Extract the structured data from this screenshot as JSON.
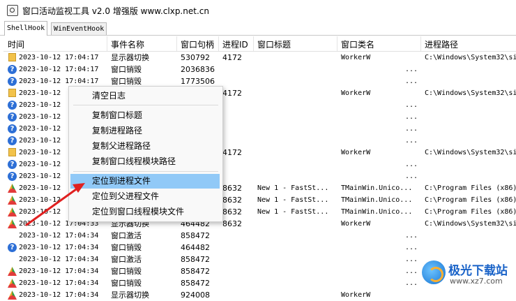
{
  "window": {
    "title": "窗口活动监视工具 v2.0 增强版 www.clxp.net.cn"
  },
  "tabs": [
    {
      "label": "ShellHook"
    },
    {
      "label": "WinEventHook"
    }
  ],
  "columns": [
    "时间",
    "事件名称",
    "窗口句柄",
    "进程ID",
    "窗口标题",
    "窗口类名",
    "进程路径"
  ],
  "rows": [
    {
      "icon": "folder-icon",
      "time": "2023-10-12 17:04:17",
      "event": "显示器切换",
      "hwnd": "530792",
      "pid": "4172",
      "wtitle": "",
      "cls": "WorkerW",
      "path": "C:\\Windows\\System32\\si"
    },
    {
      "icon": "help-icon",
      "time": "2023-10-12 17:04:17",
      "event": "窗口销毁",
      "hwnd": "2036836",
      "pid": "",
      "wtitle": "",
      "cls": "...",
      "path": ""
    },
    {
      "icon": "help-icon",
      "time": "2023-10-12 17:04:17",
      "event": "窗口销毁",
      "hwnd": "1773506",
      "pid": "",
      "wtitle": "",
      "cls": "...",
      "path": ""
    },
    {
      "icon": "folder-icon",
      "time": "2023-10-12",
      "event": "",
      "hwnd": "",
      "pid": "4172",
      "wtitle": "",
      "cls": "WorkerW",
      "path": "C:\\Windows\\System32\\si"
    },
    {
      "icon": "help-icon",
      "time": "2023-10-12",
      "event": "",
      "hwnd": "",
      "pid": "",
      "wtitle": "",
      "cls": "...",
      "path": ""
    },
    {
      "icon": "help-icon",
      "time": "2023-10-12",
      "event": "",
      "hwnd": "",
      "pid": "",
      "wtitle": "",
      "cls": "...",
      "path": ""
    },
    {
      "icon": "help-icon",
      "time": "2023-10-12",
      "event": "",
      "hwnd": "",
      "pid": "",
      "wtitle": "",
      "cls": "...",
      "path": ""
    },
    {
      "icon": "help-icon",
      "time": "2023-10-12",
      "event": "",
      "hwnd": "",
      "pid": "",
      "wtitle": "",
      "cls": "...",
      "path": ""
    },
    {
      "icon": "folder-icon",
      "time": "2023-10-12",
      "event": "",
      "hwnd": "",
      "pid": "4172",
      "wtitle": "",
      "cls": "WorkerW",
      "path": "C:\\Windows\\System32\\si"
    },
    {
      "icon": "help-icon",
      "time": "2023-10-12",
      "event": "",
      "hwnd": "",
      "pid": "",
      "wtitle": "",
      "cls": "...",
      "path": ""
    },
    {
      "icon": "help-icon",
      "time": "2023-10-12",
      "event": "",
      "hwnd": "",
      "pid": "",
      "wtitle": "",
      "cls": "...",
      "path": ""
    },
    {
      "icon": "app-icon",
      "time": "2023-10-12",
      "event": "",
      "hwnd": "",
      "pid": "8632",
      "wtitle": "New 1 - FastSt...",
      "cls": "TMainWin.Unico...",
      "path": "C:\\Program Files (x86)"
    },
    {
      "icon": "app-icon",
      "time": "2023-10-12",
      "event": "",
      "hwnd": "",
      "pid": "8632",
      "wtitle": "New 1 - FastSt...",
      "cls": "TMainWin.Unico...",
      "path": "C:\\Program Files (x86)"
    },
    {
      "icon": "app-icon",
      "time": "2023-10-12",
      "event": "",
      "hwnd": "",
      "pid": "8632",
      "wtitle": "New 1 - FastSt...",
      "cls": "TMainWin.Unico...",
      "path": "C:\\Program Files (x86)"
    },
    {
      "icon": "app-icon",
      "time": "2023-10-12 17:04:33",
      "event": "显示器切换",
      "hwnd": "464482",
      "pid": "8632",
      "wtitle": "",
      "cls": "WorkerW",
      "path": "C:\\Windows\\System32\\si"
    },
    {
      "icon": "none",
      "time": "2023-10-12 17:04:34",
      "event": "窗口激活",
      "hwnd": "858472",
      "pid": "",
      "wtitle": "",
      "cls": "...",
      "path": ""
    },
    {
      "icon": "help-icon",
      "time": "2023-10-12 17:04:34",
      "event": "窗口销毁",
      "hwnd": "464482",
      "pid": "",
      "wtitle": "",
      "cls": "...",
      "path": ""
    },
    {
      "icon": "none",
      "time": "2023-10-12 17:04:34",
      "event": "窗口激活",
      "hwnd": "858472",
      "pid": "",
      "wtitle": "",
      "cls": "...",
      "path": ""
    },
    {
      "icon": "app-icon",
      "time": "2023-10-12 17:04:34",
      "event": "窗口销毁",
      "hwnd": "858472",
      "pid": "",
      "wtitle": "",
      "cls": "...",
      "path": ""
    },
    {
      "icon": "app-icon",
      "time": "2023-10-12 17:04:34",
      "event": "窗口销毁",
      "hwnd": "858472",
      "pid": "",
      "wtitle": "",
      "cls": "...",
      "path": ""
    },
    {
      "icon": "app-icon",
      "time": "2023-10-12 17:04:34",
      "event": "显示器切换",
      "hwnd": "924008",
      "pid": "",
      "wtitle": "",
      "cls": "WorkerW",
      "path": ""
    }
  ],
  "context_menu": {
    "groups": [
      [
        "清空日志"
      ],
      [
        "复制窗口标题",
        "复制进程路径",
        "复制父进程路径",
        "复制窗口线程模块路径"
      ],
      [
        "定位到进程文件",
        "定位到父进程文件",
        "定位到窗口线程模块文件"
      ]
    ],
    "highlighted": "定位到进程文件"
  },
  "watermark": {
    "name": "极光下载站",
    "url": "www.xz7.com"
  },
  "colors": {
    "menu_highlight": "#91c9f7",
    "arrow": "#e02020",
    "help_icon": "#2d6fd6"
  }
}
